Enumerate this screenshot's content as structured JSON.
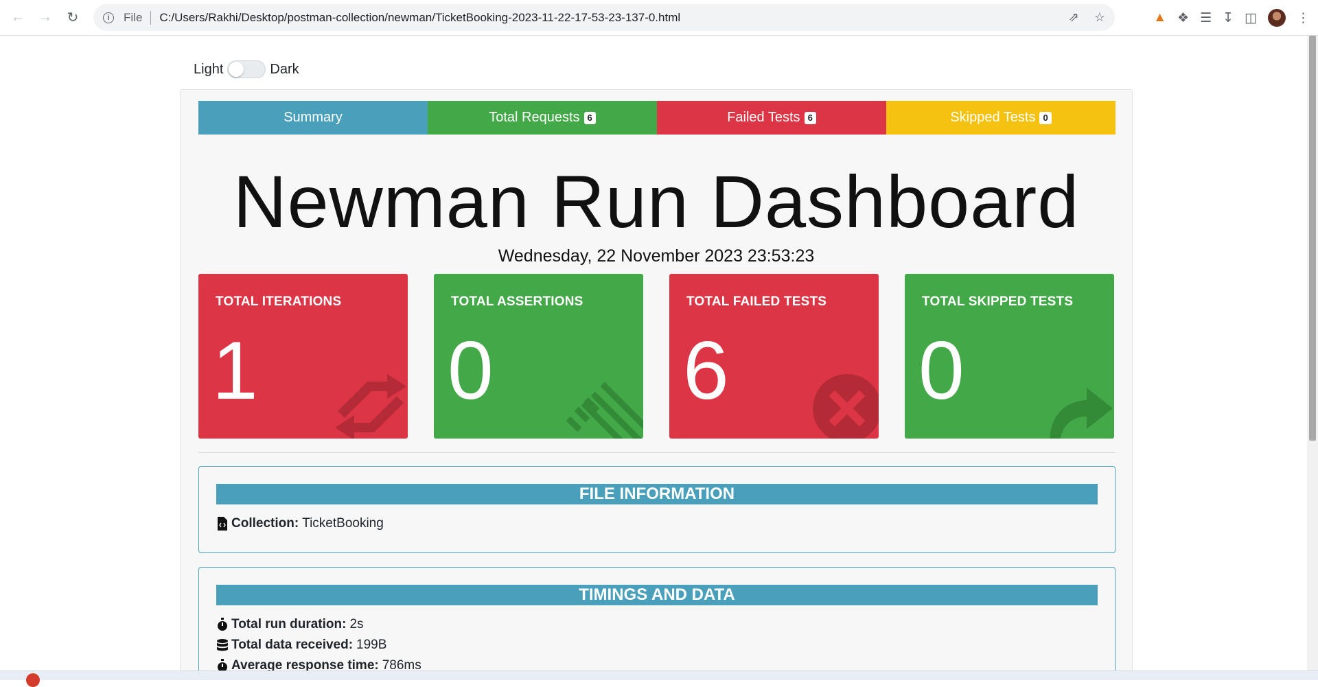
{
  "browser": {
    "file_label": "File",
    "url": "C:/Users/Rakhi/Desktop/postman-collection/newman/TicketBooking-2023-11-22-17-53-23-137-0.html"
  },
  "theme": {
    "light_label": "Light",
    "dark_label": "Dark"
  },
  "tabs": [
    {
      "label": "Summary",
      "badge": ""
    },
    {
      "label": "Total Requests",
      "badge": "6"
    },
    {
      "label": "Failed Tests",
      "badge": "6"
    },
    {
      "label": "Skipped Tests",
      "badge": "0"
    }
  ],
  "page": {
    "title": "Newman Run Dashboard",
    "datetime": "Wednesday, 22 November 2023 23:53:23"
  },
  "cards": [
    {
      "label": "TOTAL ITERATIONS",
      "value": "1",
      "color": "#dc3545",
      "icon": "sync-icon"
    },
    {
      "label": "TOTAL ASSERTIONS",
      "value": "0",
      "color": "#43a847",
      "icon": "list-icon"
    },
    {
      "label": "TOTAL FAILED TESTS",
      "value": "6",
      "color": "#dc3545",
      "icon": "times-circle-icon"
    },
    {
      "label": "TOTAL SKIPPED TESTS",
      "value": "0",
      "color": "#43a847",
      "icon": "share-arrow-icon"
    }
  ],
  "file_info": {
    "heading": "FILE INFORMATION",
    "collection_label": "Collection:",
    "collection_value": "TicketBooking"
  },
  "timings": {
    "heading": "TIMINGS AND DATA",
    "rows": [
      {
        "label": "Total run duration:",
        "value": "2s"
      },
      {
        "label": "Total data received:",
        "value": "199B"
      },
      {
        "label": "Average response time:",
        "value": "786ms"
      }
    ]
  },
  "colors": {
    "summary": "#4aa0bb",
    "success": "#43a847",
    "danger": "#dc3545",
    "warning": "#f5c211"
  }
}
